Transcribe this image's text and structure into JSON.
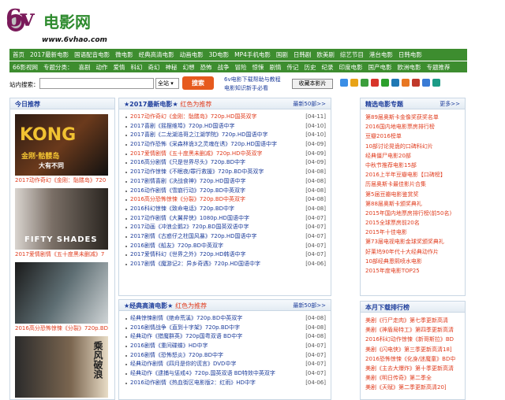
{
  "logo": {
    "mark": "6v",
    "cn": "电影网",
    "url": "www.6vhao.com"
  },
  "nav1": [
    "首页",
    "2017最新电影",
    "国语配音电影",
    "微电影",
    "经典高清电影",
    "动画电影",
    "3D电影",
    "MP4手机电影",
    "国剧",
    "日韩剧",
    "欧美剧",
    "综艺节目",
    "港台电影",
    "日韩电影"
  ],
  "nav2": [
    "66影视网",
    "专题分类：",
    "喜剧",
    "动作",
    "爱情",
    "科幻",
    "奇幻",
    "神秘",
    "幻想",
    "恐怖",
    "战争",
    "冒险",
    "惊悚",
    "剧情",
    "传记",
    "历史",
    "纪录",
    "印度电影",
    "国产电影",
    "欧洲电影",
    "专题推荐"
  ],
  "search": {
    "label": "站内搜索：",
    "value": "",
    "select": "全站 ▾",
    "button": "搜索",
    "help1": "6v电影下载帮助与教程",
    "help2": "电影知识新手必看",
    "fav": "收藏本影片"
  },
  "left": {
    "title": "今日推荐",
    "posters": [
      {
        "cap": "2017动作奇幻《金刚：骷髅岛》720",
        "text1": "KONG",
        "text2": "金刚·骷髅岛",
        "text3": "大有不同"
      },
      {
        "cap": "2017爱情剧情《五十度黑未删减》7",
        "text1": "FIFTY SHADES",
        "text2": "",
        "text3": ""
      },
      {
        "cap": "2016高分恐怖惊悚《分裂》720p.BD",
        "text1": "",
        "text2": "",
        "text3": ""
      },
      {
        "cap": "",
        "text1": "乘风破浪",
        "text2": "",
        "text3": ""
      }
    ]
  },
  "mid1": {
    "title": "2017最新电影",
    "hl": "红色为推荐",
    "more": "最新50部>>",
    "rows": [
      {
        "t": "2017动作奇幻《金刚：骷髅岛》720p.HD国英双字",
        "d": "[04-11]",
        "red": true
      },
      {
        "t": "2017喜剧《摇摆维埠》720p.HD国语中字",
        "d": "[04-10]",
        "red": false
      },
      {
        "t": "2017喜剧《二龙湖浩哥之江湖学院》720p.HD国语中字",
        "d": "[04-10]",
        "red": false
      },
      {
        "t": "2017动作恐怖《采森林诡3之灵魂在诱》720p.HD国语中字",
        "d": "[04-09]",
        "red": false
      },
      {
        "t": "2017爱情剧情《五十度黑未删减》720p.HD中英双字",
        "d": "[04-09]",
        "red": true
      },
      {
        "t": "2016高分剧情《只是世界尽头》720p.BD中字",
        "d": "[04-09]",
        "red": false
      },
      {
        "t": "2017动作惊悚《不眠夜/罪行救援》720p.BD中英双字",
        "d": "[04-08]",
        "red": false
      },
      {
        "t": "2017剧情喜剧《决战食神》720p.HD国语中字",
        "d": "[04-08]",
        "red": false
      },
      {
        "t": "2016动作剧情《雪崩行动》720p.BD中英双字",
        "d": "[04-08]",
        "red": false
      },
      {
        "t": "2016高分恐怖惊悚《分裂》720p.BD中英双字",
        "d": "[04-08]",
        "red": true
      },
      {
        "t": "2016科幻惊悚《致命电话》720p.BD中字",
        "d": "[04-08]",
        "red": false
      },
      {
        "t": "2017动作剧情《大翼昇侠》1080p.HD国语中字",
        "d": "[04-07]",
        "red": false
      },
      {
        "t": "2017动画《冲浪企鹅2》720p.BD国英双语中字",
        "d": "[04-07]",
        "red": false
      },
      {
        "t": "2017剧情《古惑仔之柱国风暴》720p.HD国语中字",
        "d": "[04-07]",
        "red": false
      },
      {
        "t": "2016剧情《船友》720p.BD中英双字",
        "d": "[04-07]",
        "red": false
      },
      {
        "t": "2017爱情科幻《世界之外》720p.HD韩语中字",
        "d": "[04-07]",
        "red": false
      },
      {
        "t": "2017剧情《魔游记2：异乡奇遇》720p.HD国语中字",
        "d": "[04-06]",
        "red": false
      }
    ]
  },
  "mid2": {
    "title": "经典高清电影",
    "hl": "红色为推荐",
    "more": "最新50部>>",
    "rows": [
      {
        "t": "经典惊悚剧情《绝命荒溪》720p.BD中英双字",
        "d": "[04-08]",
        "red": false
      },
      {
        "t": "2016剧情战争《直到十字架》720p.BD中字",
        "d": "[04-08]",
        "red": false
      },
      {
        "t": "经典动作《猎魔群英》720p国粤双语 BD中字",
        "d": "[04-08]",
        "red": false
      },
      {
        "t": "2016剧情《重间碟蝶》HD中字",
        "d": "[04-07]",
        "red": false
      },
      {
        "t": "2016剧情《恐怖怒炎》720p.BD中字",
        "d": "[04-07]",
        "red": false
      },
      {
        "t": "经典动作剧情《四月是你的谎言》DVD中字",
        "d": "[04-07]",
        "red": false
      },
      {
        "t": "经典动作《逮捕与惩戒4》720p.国英双语 BD特效中英双字",
        "d": "[04-07]",
        "red": false
      },
      {
        "t": "2016动作剧情《热血街区电影版2：红雨》HD中字",
        "d": "[04-06]",
        "red": false
      }
    ]
  },
  "right1": {
    "title": "精选电影专题",
    "more": "更多>>",
    "rows": [
      "第89届奥斯卡金像奖获奖名单",
      "2016国内地电影票房排行榜",
      "豆瓣2016榜单",
      "10部讨论晃诡的口碑科幻片",
      "经典僵尸电影20部",
      "中秋节推荐电影15部",
      "2016上半年豆瓣电影【口碑榜】",
      "历届奥斯卡最佳影片合集",
      "第5届豆瓣电影鉴赏奖",
      "第88届奥斯卡颁奖典礼",
      "2015年国内地票房排行榜(前50名)",
      "2015全球票房前20名",
      "2015年十佳电影",
      "第73届电视电影金球奖颁奖典礼",
      "好莱坞90年代十大经典动作片",
      "10部经典恩熙喷水电影",
      "2015年度电影TOP25"
    ]
  },
  "right2": {
    "title": "本月下载排行榜",
    "rows": [
      "美剧《行尸走肉》第七季更新高清",
      "美剧《神盾局特工》第四季更新高清",
      "2016科幻动作惊悚《新哥斯拉》BD",
      "美剧《闪电侠》第三季更新高清18]",
      "2016恐怖惊悚《化身/迷魔童》BD中",
      "美剧《主去大爆炸》第十季更新高清",
      "美剧《明日传奇》第二季全",
      "美剧《天赋》第二季更新高清20]"
    ]
  }
}
